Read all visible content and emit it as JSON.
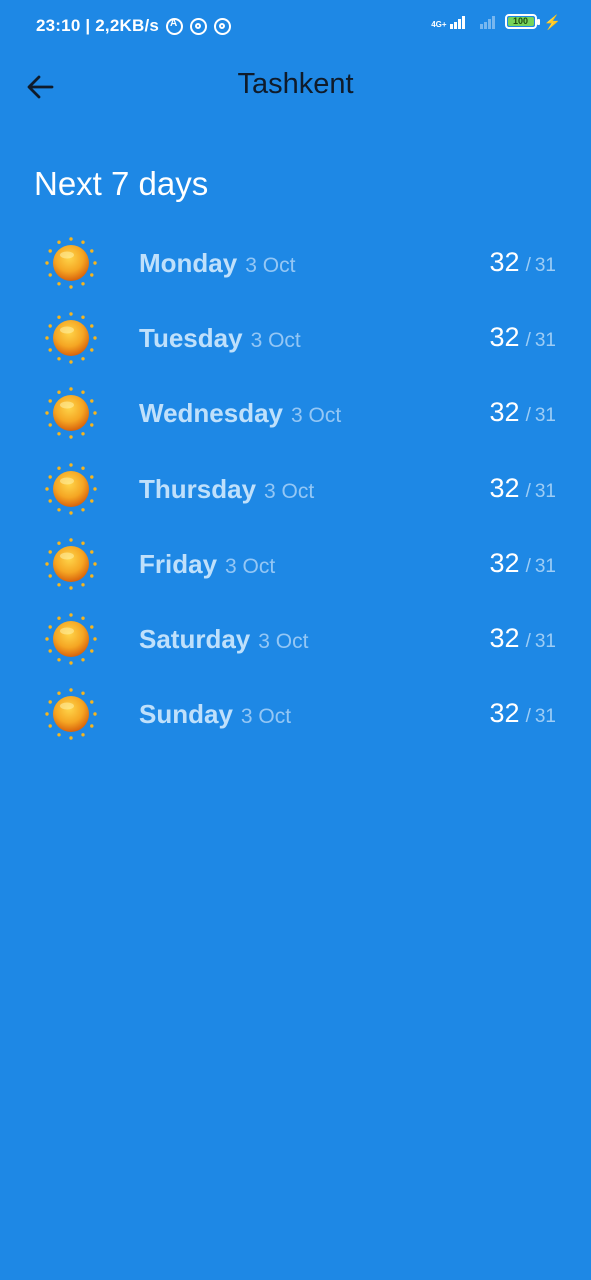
{
  "status_bar": {
    "time_speed": "23:10 | 2,2KB/s",
    "network": "4G+",
    "battery": "100"
  },
  "header": {
    "title": "Tashkent",
    "back_icon": "arrow-left-icon"
  },
  "section": {
    "title": "Next 7 days"
  },
  "days": [
    {
      "name": "Monday",
      "date": "3 Oct",
      "high": "32",
      "low": "31",
      "icon": "sun-icon"
    },
    {
      "name": "Tuesday",
      "date": "3 Oct",
      "high": "32",
      "low": "31",
      "icon": "sun-icon"
    },
    {
      "name": "Wednesday",
      "date": "3 Oct",
      "high": "32",
      "low": "31",
      "icon": "sun-icon"
    },
    {
      "name": "Thursday",
      "date": "3 Oct",
      "high": "32",
      "low": "31",
      "icon": "sun-icon"
    },
    {
      "name": "Friday",
      "date": "3 Oct",
      "high": "32",
      "low": "31",
      "icon": "sun-icon"
    },
    {
      "name": "Saturday",
      "date": "3 Oct",
      "high": "32",
      "low": "31",
      "icon": "sun-icon"
    },
    {
      "name": "Sunday",
      "date": "3 Oct",
      "high": "32",
      "low": "31",
      "icon": "sun-icon"
    }
  ],
  "temp_separator": "/",
  "colors": {
    "background": "#1E88E5",
    "title_text": "#0F1B2A",
    "day_name": "#BFE0FB",
    "sun_core": "#F5A623"
  }
}
